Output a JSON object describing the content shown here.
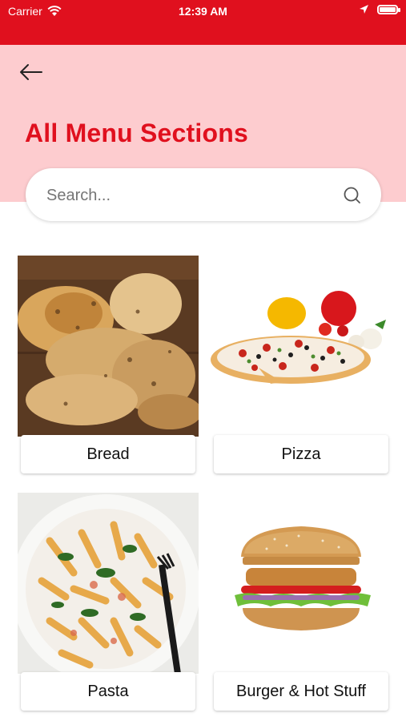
{
  "status_bar": {
    "carrier": "Carrier",
    "time": "12:39 AM",
    "icons": [
      "wifi-icon",
      "location-arrow-icon",
      "battery-icon"
    ]
  },
  "header": {
    "back_icon": "arrow-left-icon",
    "title": "All Menu Sections"
  },
  "search": {
    "placeholder": "Search...",
    "value": "",
    "icon": "search-icon"
  },
  "sections": [
    {
      "name": "Bread",
      "image": "bread-image"
    },
    {
      "name": "Pizza",
      "image": "pizza-image"
    },
    {
      "name": "Pasta",
      "image": "pasta-image"
    },
    {
      "name": "Burger & Hot Stuff",
      "image": "burger-image"
    }
  ],
  "colors": {
    "brand_red": "#e0101e",
    "header_pink": "#fdcccf",
    "text": "#111111"
  }
}
